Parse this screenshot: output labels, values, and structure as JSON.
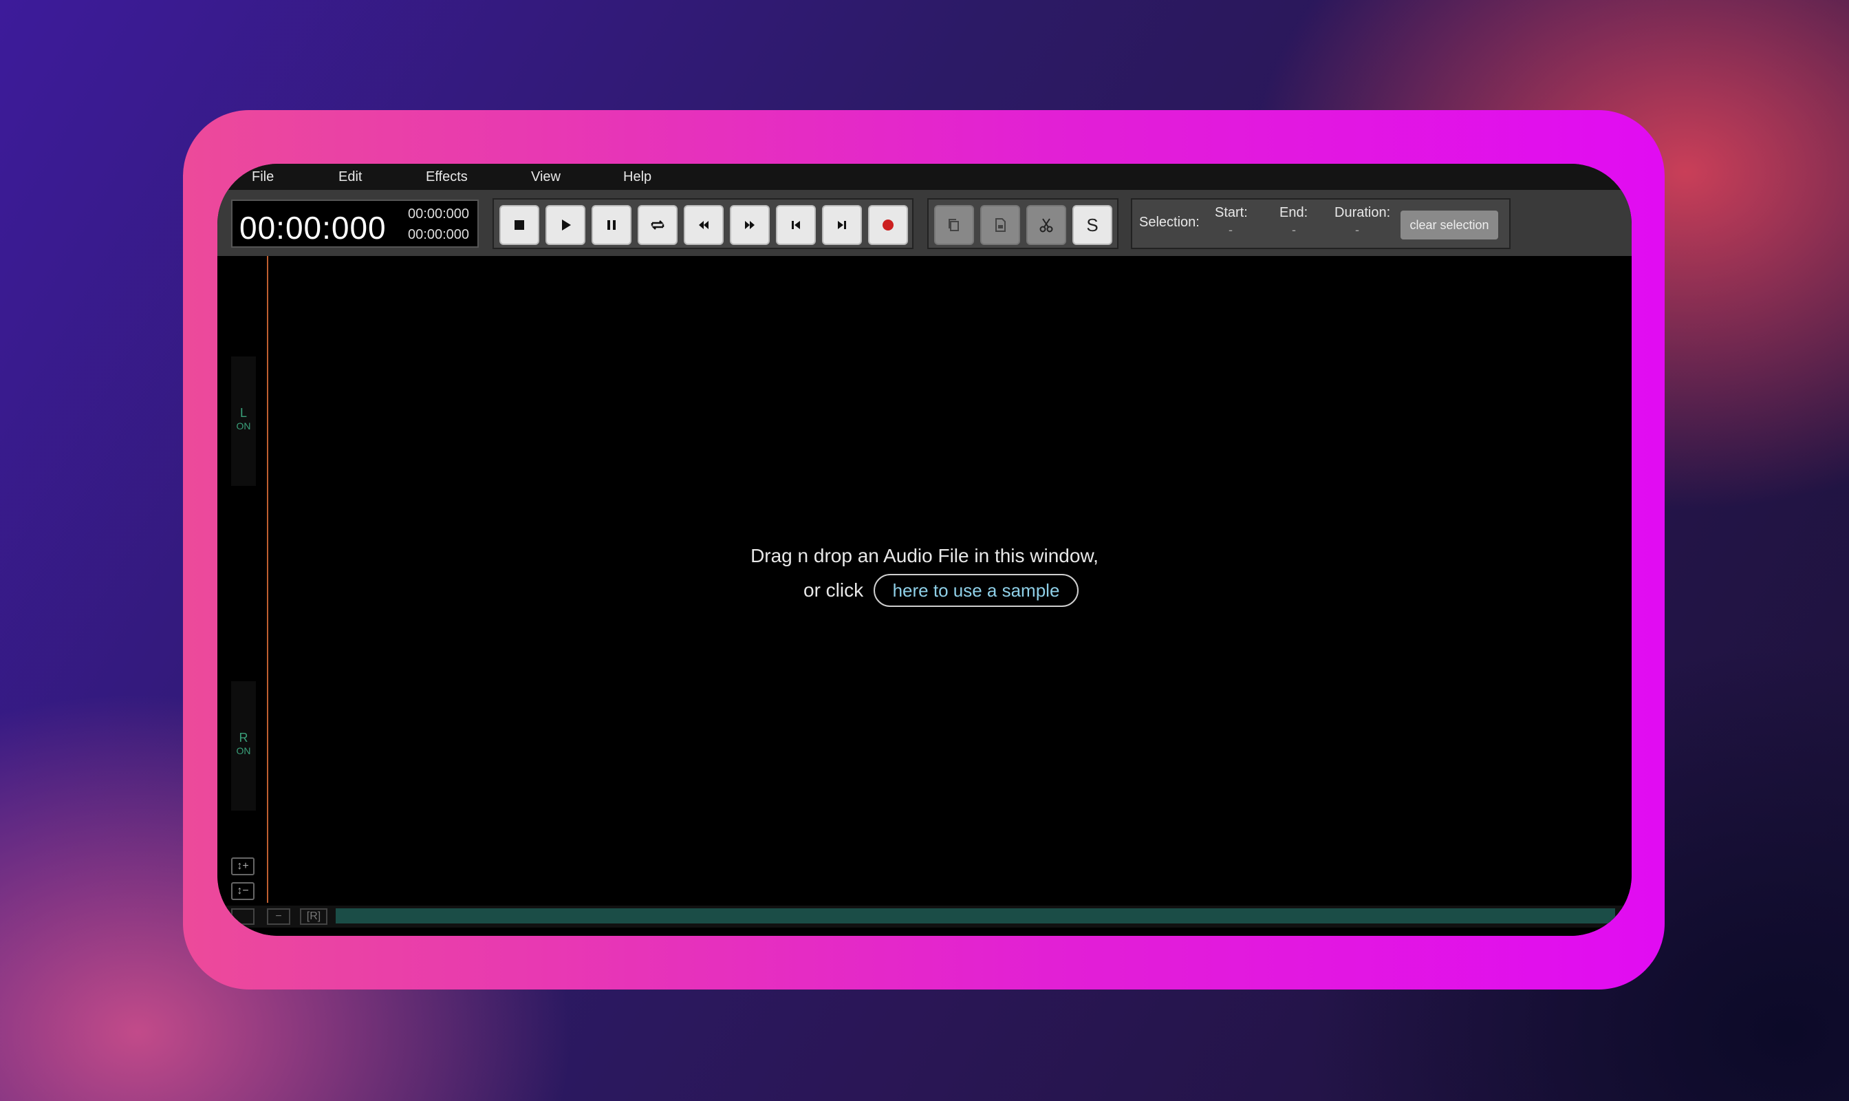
{
  "menu": {
    "items": [
      {
        "label": "File"
      },
      {
        "label": "Edit"
      },
      {
        "label": "Effects"
      },
      {
        "label": "View"
      },
      {
        "label": "Help"
      }
    ]
  },
  "time": {
    "main": "00:00:000",
    "sub1": "00:00:000",
    "sub2": "00:00:000"
  },
  "transport": {
    "icons": [
      "stop-icon",
      "play-icon",
      "pause-icon",
      "loop-icon",
      "rewind-icon",
      "fast-forward-icon",
      "skip-start-icon",
      "skip-end-icon",
      "record-icon"
    ]
  },
  "edit_tools": {
    "icons": [
      "copy-icon",
      "paste-icon",
      "cut-icon"
    ],
    "s_label": "S"
  },
  "selection": {
    "label": "Selection:",
    "start_label": "Start:",
    "start_value": "-",
    "end_label": "End:",
    "end_value": "-",
    "duration_label": "Duration:",
    "duration_value": "-",
    "clear_label": "clear selection"
  },
  "channels": {
    "left": {
      "label": "L",
      "state": "ON"
    },
    "right": {
      "label": "R",
      "state": "ON"
    }
  },
  "zoom": {
    "in": "↕+",
    "out": "↕−"
  },
  "bottom": {
    "minus": "−",
    "reset": "[R]"
  },
  "drop": {
    "line1": "Drag n drop an Audio File in this window,",
    "line2": "or click",
    "sample_link": "here to use a sample"
  },
  "colors": {
    "frame_gradient_start": "#ec4a9a",
    "frame_gradient_end": "#e10cf2",
    "record": "#cc1f1f",
    "playhead": "#e0703a",
    "scrollbar": "#1b4d47",
    "link": "#8fd0e8"
  }
}
